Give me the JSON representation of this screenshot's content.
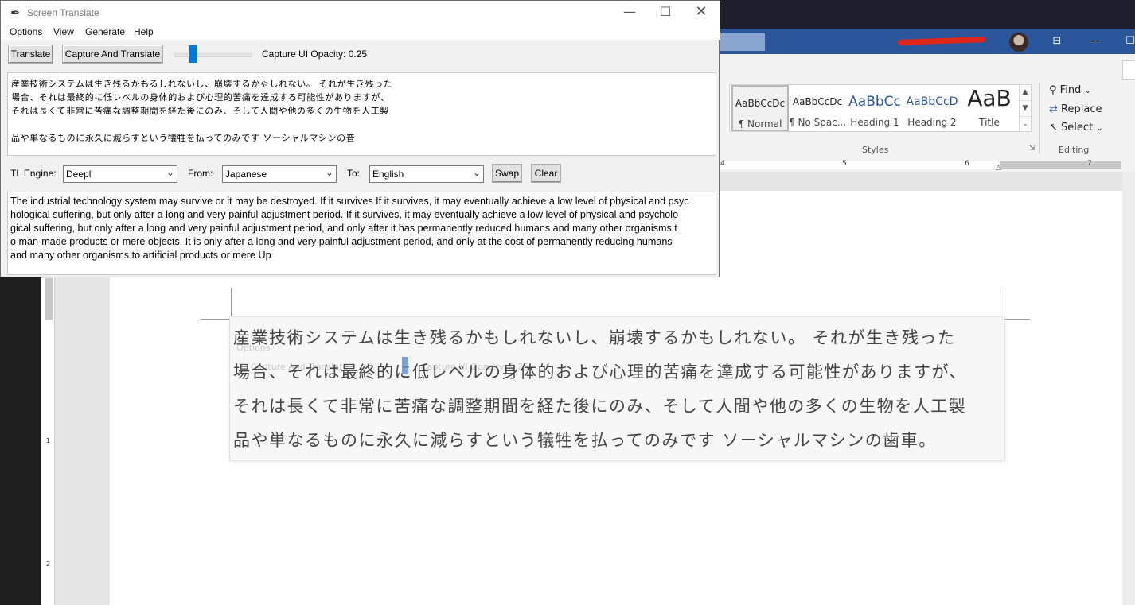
{
  "app": {
    "title": "Screen Translate",
    "title_icon": "feather-icon",
    "menus": [
      "Options",
      "View",
      "Generate",
      "Help"
    ],
    "toolbar": {
      "translate_label": "Translate",
      "capture_translate_label": "Capture And Translate",
      "opacity_label": "Capture UI Opacity: 0.25",
      "opacity_value": 0.25
    },
    "source_lines": [
      "産業技術システムは生き残るかもるしれないし、崩壊するかゃしれない。 それが生き残った",
      "場合、それは最終的に低レベルの身体的および心理的苦痛を達成する可能性がありますが、",
      "それは長くて非常に苦痛な調整期間を経た後にのみ、そして人間や他の多くの生物を人工製",
      "",
      "品や単なるものに永久に滅らすという犠牲を払ってのみです ソーシャルマシンの普"
    ],
    "engine_row": {
      "tl_engine_label": "TL Engine:",
      "tl_engine_value": "Deepl",
      "from_label": "From:",
      "from_value": "Japanese",
      "to_label": "To:",
      "to_value": "English",
      "swap_label": "Swap",
      "clear_label": "Clear"
    },
    "translation_lines": [
      "The industrial technology system may survive or it may be destroyed. If it survives If it survives, it may eventually achieve a low level of physical and psyc",
      "hological suffering, but only after a long and very painful adjustment period. If it survives, it may eventually achieve a low level of physical and psycholo",
      "gical suffering, but only after a long and very painful adjustment period, and only after it has permanently reduced humans and many other organisms t",
      "o man-made products or mere objects. It is only after a long and very painful adjustment period, and only at the cost of permanently reducing humans",
      "and many other organisms to artificial products or mere Up"
    ]
  },
  "word": {
    "styles": [
      {
        "preview": "AaBbCcDc",
        "name": "¶ Normal"
      },
      {
        "preview": "AaBbCcDc",
        "name": "¶ No Spac..."
      },
      {
        "preview": "AaBbCc",
        "name": "Heading 1"
      },
      {
        "preview": "AaBbCcD",
        "name": "Heading 2"
      },
      {
        "preview": "AaB",
        "name": "Title"
      }
    ],
    "styles_group": "Styles",
    "editing": {
      "find": "Find",
      "replace": "Replace",
      "select": "Select",
      "group": "Editing"
    },
    "ruler_numbers": [
      "4",
      "5",
      "6",
      "7"
    ],
    "vruler_numbers": [
      "1",
      "2"
    ],
    "overlay_ghost": {
      "options": "Options",
      "capture": "Capture And Translate",
      "opacity": "Capture UI Opacity: 0.25"
    },
    "doc_lines": [
      "産業技術システムは生き残るかもしれないし、崩壊するかもしれない。 それが生き残った",
      "場合、それは最終的に低レベルの身体的および心理的苦痛を達成する可能性がありますが、",
      "それは長くて非常に苦痛な調整期間を経た後にのみ、そして人間や他の多くの生物を人工製",
      "品や単なるものに永久に減らすという犠牲を払ってのみです ソーシャルマシンの歯車。"
    ]
  },
  "colors": {
    "accent": "#0078d7",
    "word_blue": "#2b579a",
    "heading_blue": "#2f5496"
  }
}
